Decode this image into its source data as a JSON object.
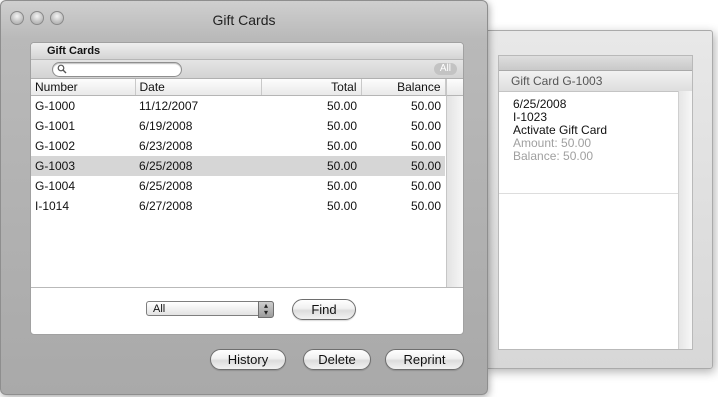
{
  "main_window": {
    "title": "Gift Cards",
    "panel_title": "Gift Cards",
    "search": {
      "value": "",
      "placeholder": ""
    },
    "all_badge": "All",
    "columns": [
      "Number",
      "Date",
      "Total",
      "Balance"
    ],
    "rows": [
      {
        "number": "G-1000",
        "date": "11/12/2007",
        "total": "50.00",
        "balance": "50.00"
      },
      {
        "number": "G-1001",
        "date": "6/19/2008",
        "total": "50.00",
        "balance": "50.00"
      },
      {
        "number": "G-1002",
        "date": "6/23/2008",
        "total": "50.00",
        "balance": "50.00"
      },
      {
        "number": "G-1003",
        "date": "6/25/2008",
        "total": "50.00",
        "balance": "50.00"
      },
      {
        "number": "G-1004",
        "date": "6/25/2008",
        "total": "50.00",
        "balance": "50.00"
      },
      {
        "number": "I-1014",
        "date": "6/27/2008",
        "total": "50.00",
        "balance": "50.00"
      }
    ],
    "selected_row": 3,
    "filter_select": {
      "selected": "All"
    },
    "find_label": "Find",
    "buttons": {
      "history": "History",
      "delete": "Delete",
      "reprint": "Reprint"
    }
  },
  "detail_window": {
    "title": "Gift Card G-1003",
    "lines": [
      "6/25/2008",
      "I-1023",
      "Activate Gift Card"
    ],
    "amount": "Amount: 50.00",
    "balance": "Balance: 50.00"
  },
  "icons": {
    "search": "magnifier-icon",
    "select_arrows": "up-down-arrows-icon"
  },
  "colors": {
    "selection": "#d6d6d6",
    "window_chrome": "#b9b9b9",
    "dim_text": "#a0a0a0"
  }
}
